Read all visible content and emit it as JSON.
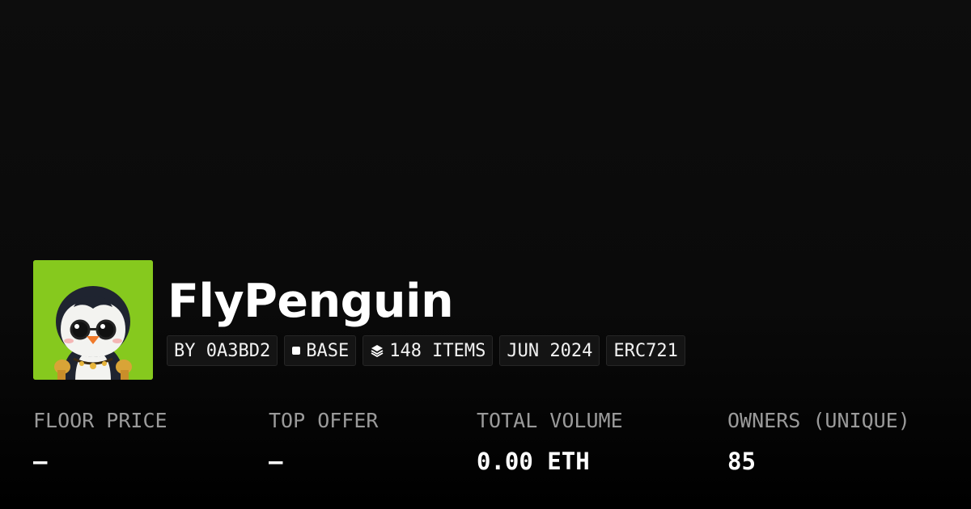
{
  "collection": {
    "name": "FlyPenguin",
    "avatar_bg": "#86c91e",
    "avatar_icon": "penguin-avatar"
  },
  "tags": [
    {
      "label": "BY 0A3BD2",
      "icon": ""
    },
    {
      "label": "BASE",
      "icon": "square-icon"
    },
    {
      "label": "148 ITEMS",
      "icon": "layers-icon"
    },
    {
      "label": "JUN 2024",
      "icon": ""
    },
    {
      "label": "ERC721",
      "icon": ""
    }
  ],
  "stats": [
    {
      "label": "FLOOR PRICE",
      "value": "—"
    },
    {
      "label": "TOP OFFER",
      "value": "—"
    },
    {
      "label": "TOTAL VOLUME",
      "value": "0.00 ETH"
    },
    {
      "label": "OWNERS (UNIQUE)",
      "value": "85"
    }
  ],
  "colors": {
    "background": "#0a0a0a",
    "tag_background": "#141414",
    "tag_border": "#262626",
    "label_text": "#9a9a9a",
    "value_text": "#ffffff"
  }
}
